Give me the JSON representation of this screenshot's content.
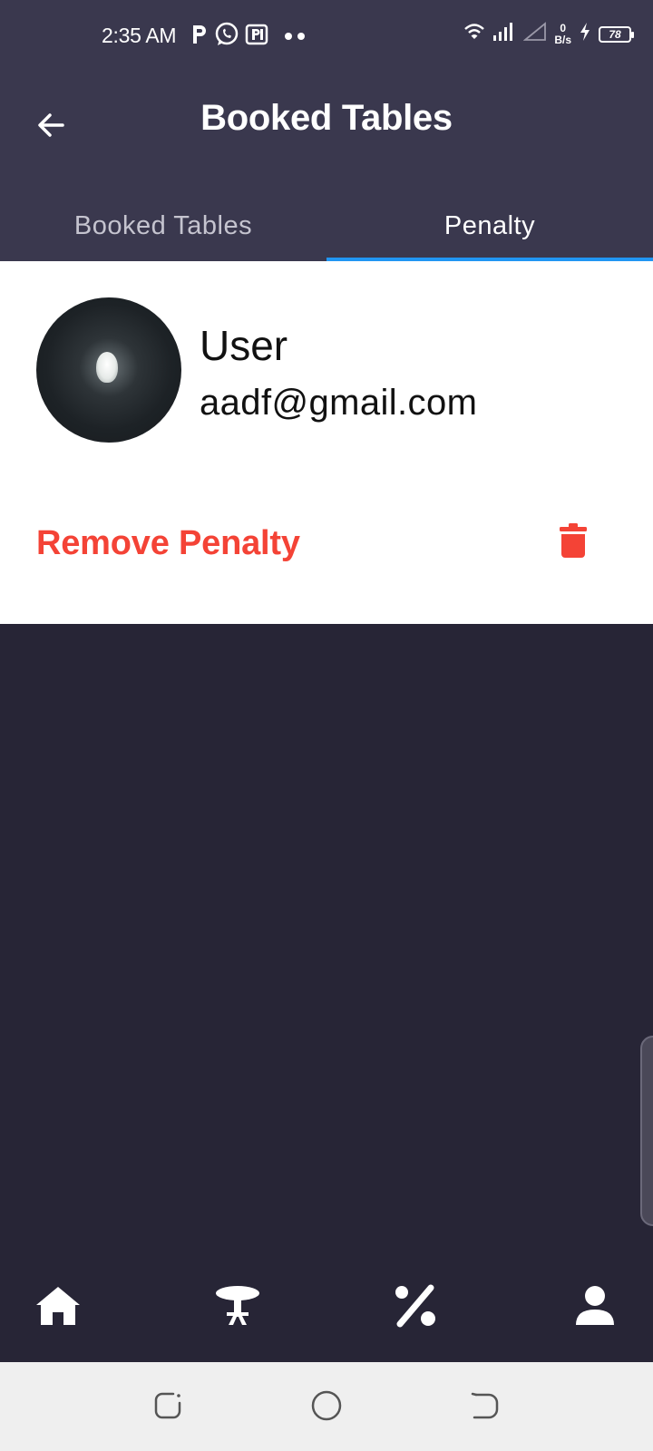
{
  "status_bar": {
    "time": "2:35 AM",
    "net_speed_value": "0",
    "net_speed_unit": "B/s",
    "battery_level": "78",
    "icons": [
      "p-icon",
      "whatsapp-icon",
      "parking-icon",
      "more-dots-icon",
      "wifi-icon",
      "signal-icon",
      "no-signal-icon",
      "charging-icon",
      "battery-icon"
    ]
  },
  "app_bar": {
    "title": "Booked Tables"
  },
  "tabs": [
    {
      "label": "Booked Tables",
      "active": false
    },
    {
      "label": "Penalty",
      "active": true
    }
  ],
  "penalty_card": {
    "user_name": "User",
    "email": "aadf@gmail.com",
    "remove_label": "Remove Penalty"
  },
  "bottom_nav": [
    "home-icon",
    "table-icon",
    "percent-icon",
    "person-icon"
  ],
  "colors": {
    "header_bg": "#3a384e",
    "page_bg": "#272536",
    "tab_indicator": "#2196f3",
    "danger": "#f44336",
    "system_nav_bg": "#efefef"
  }
}
